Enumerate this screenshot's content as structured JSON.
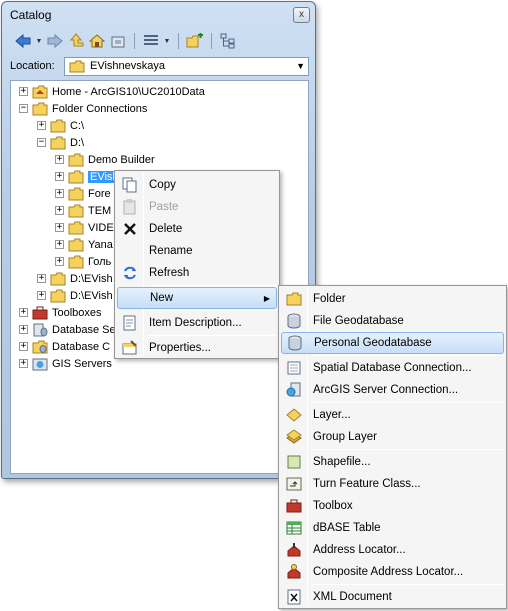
{
  "window": {
    "title": "Catalog",
    "close_glyph": "x",
    "location_label": "Location:",
    "location_value": "EVishnevskaya"
  },
  "toolbar": {
    "icons": [
      "back-icon",
      "dropdown",
      "forward-icon",
      "up-folder-icon",
      "home-icon",
      "disconnect-icon",
      "view-icon",
      "dropdown",
      "connect-folder-icon",
      "tree-toggle-icon"
    ]
  },
  "tree": {
    "home": "Home - ArcGIS10\\UC2010Data",
    "folder_connections": "Folder Connections",
    "c_drive": "C:\\",
    "d_drive": "D:\\",
    "demo_builder": "Demo Builder",
    "evishnevskaya": "EVish",
    "fore": "Fore",
    "tem": "TEM",
    "vide": "VIDE",
    "yana": "Yana",
    "gol": "Голь",
    "d_evish1": "D:\\EVish",
    "d_evish2": "D:\\EVish",
    "toolboxes": "Toolboxes",
    "db_servers": "Database Se",
    "db_connections": "Database C",
    "gis_servers": "GIS Servers"
  },
  "context_menu": {
    "copy": "Copy",
    "paste": "Paste",
    "delete": "Delete",
    "rename": "Rename",
    "refresh": "Refresh",
    "new": "New",
    "item_description": "Item Description...",
    "properties": "Properties..."
  },
  "new_menu": {
    "folder": "Folder",
    "file_gdb": "File Geodatabase",
    "personal_gdb": "Personal Geodatabase",
    "spatial_db": "Spatial Database Connection...",
    "arcgis_server": "ArcGIS Server Connection...",
    "layer": "Layer...",
    "group_layer": "Group Layer",
    "shapefile": "Shapefile...",
    "turn_feature": "Turn Feature Class...",
    "toolbox": "Toolbox",
    "dbase": "dBASE Table",
    "address_locator": "Address Locator...",
    "composite_locator": "Composite Address Locator...",
    "xml_document": "XML Document"
  },
  "colors": {
    "selection": "#3399ff",
    "menu_highlight": "#c6def8",
    "folder": "#f5d25c"
  }
}
